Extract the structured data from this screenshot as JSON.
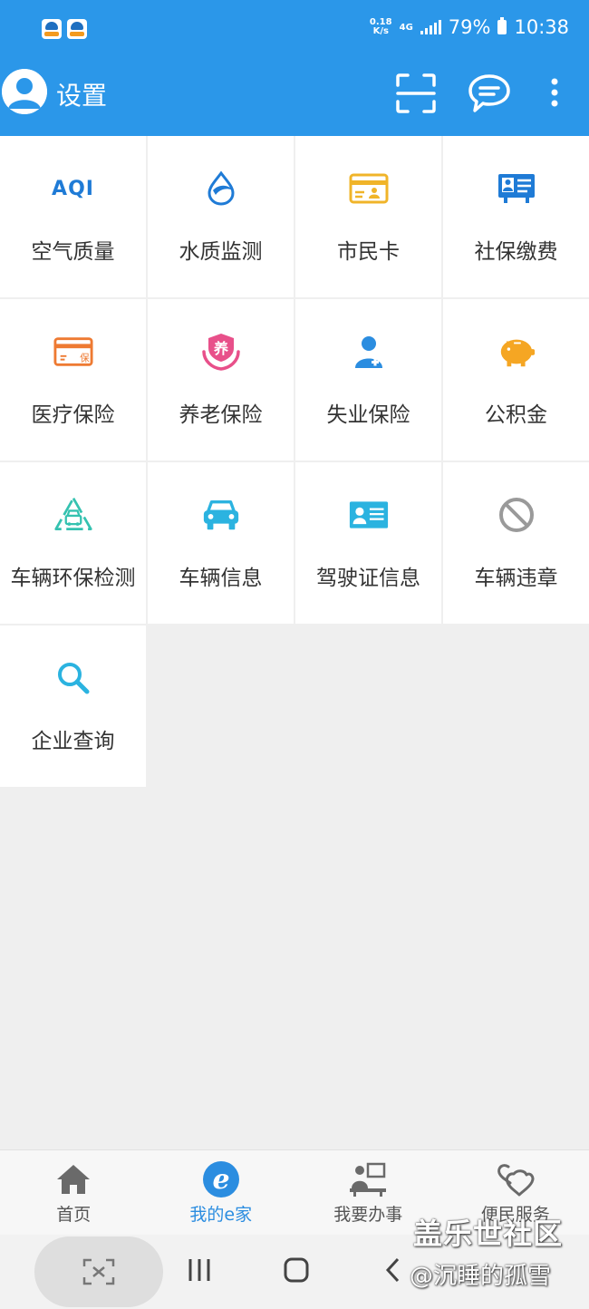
{
  "status_bar": {
    "net_speed_top": "0.18",
    "net_speed_bottom": "K/s",
    "network": "4G",
    "battery": "79%",
    "time": "10:38"
  },
  "app_bar": {
    "title": "设置"
  },
  "grid": [
    {
      "label": "空气质量",
      "icon": "aqi-icon",
      "icon_text": "AQI",
      "color": "#1f7bd6"
    },
    {
      "label": "水质监测",
      "icon": "water-drop-icon",
      "color": "#1f7bd6"
    },
    {
      "label": "市民卡",
      "icon": "citizen-card-icon",
      "color": "#f0b429"
    },
    {
      "label": "社保缴费",
      "icon": "id-card-icon",
      "color": "#1f7bd6"
    },
    {
      "label": "医疗保险",
      "icon": "medical-card-icon",
      "icon_text": "保",
      "color": "#ee7a32"
    },
    {
      "label": "养老保险",
      "icon": "pension-hands-icon",
      "icon_text": "养",
      "color": "#e8508a"
    },
    {
      "label": "失业保险",
      "icon": "person-plus-icon",
      "color": "#2b8de0"
    },
    {
      "label": "公积金",
      "icon": "piggy-bank-icon",
      "color": "#f5a623"
    },
    {
      "label": "车辆环保检测",
      "icon": "eco-car-icon",
      "color": "#35c2b0"
    },
    {
      "label": "车辆信息",
      "icon": "car-icon",
      "color": "#2bb3e0"
    },
    {
      "label": "驾驶证信息",
      "icon": "license-card-icon",
      "color": "#2bb3e0"
    },
    {
      "label": "车辆违章",
      "icon": "prohibited-icon",
      "color": "#9a9a9a"
    },
    {
      "label": "企业查询",
      "icon": "search-icon",
      "color": "#2bb3e0"
    }
  ],
  "bottom_nav": [
    {
      "label": "首页",
      "icon": "home-icon"
    },
    {
      "label": "我的e家",
      "icon": "e-home-icon",
      "active": true
    },
    {
      "label": "我要办事",
      "icon": "office-worker-icon"
    },
    {
      "label": "便民服务",
      "icon": "heart-service-icon"
    }
  ],
  "watermark": {
    "line1": "盖乐世社区",
    "line2": "@沉睡的孤雪"
  }
}
